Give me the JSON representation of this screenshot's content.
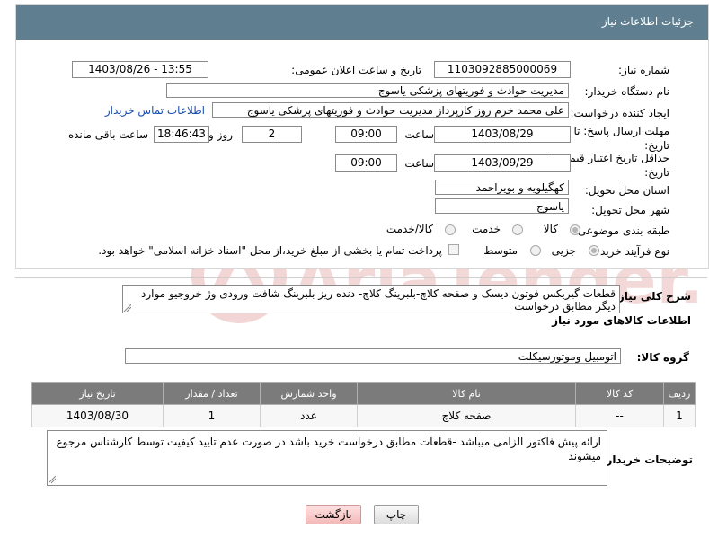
{
  "header": {
    "title": "جزئیات اطلاعات نیاز"
  },
  "fields": {
    "need_number_label": "شماره نیاز:",
    "need_number": "1103092885000069",
    "announce_label": "تاریخ و ساعت اعلان عمومی:",
    "announce_value": "1403/08/26 - 13:55",
    "buyer_org_label": "نام دستگاه خریدار:",
    "buyer_org": "مدیریت حوادث و فوریتهای پزشکی یاسوج",
    "creator_label": "ایجاد کننده درخواست:",
    "creator": "علی محمد خرم روز کارپرداز مدیریت حوادث و فوریتهای پزشکی یاسوج",
    "contact_link": "اطلاعات تماس خریدار",
    "deadline_label": "مهلت ارسال پاسخ: تا تاریخ:",
    "deadline_date": "1403/08/29",
    "time_word": "ساعت",
    "deadline_time": "09:00",
    "days_value": "2",
    "days_word": "روز و",
    "remaining_time": "18:46:43",
    "remaining_word": "ساعت باقی مانده",
    "validity_label": "حداقل تاریخ اعتبار قیمت: تا تاریخ:",
    "validity_date": "1403/09/29",
    "validity_time": "09:00",
    "province_label": "استان محل تحویل:",
    "province": "کهگیلویه و بویراحمد",
    "city_label": "شهر محل تحویل:",
    "city": "یاسوج",
    "category_label": "طبقه بندی موضوعی:",
    "category_options": [
      "کالا",
      "خدمت",
      "کالا/خدمت"
    ],
    "process_label": "نوع فرآیند خرید :",
    "process_options": [
      "جزیی",
      "متوسط"
    ],
    "payment_note": "پرداخت تمام یا بخشی از مبلغ خرید،از محل \"اسناد خزانه اسلامی\" خواهد بود."
  },
  "description": {
    "label": "شرح کلی نیاز:",
    "text": "قطعات گیربکس فوتون دیسک و صفحه کلاچ-بلبرینگ کلاچ- دنده ریز بلبرینگ شافت ورودی وژ خروجیو موارد دیگر مطابق درخواست"
  },
  "goods": {
    "section_title": "اطلاعات کالاهای مورد نیاز",
    "group_label": "گروه کالا:",
    "group_value": "اتومبیل وموتورسیکلت",
    "columns": [
      "ردیف",
      "کد کالا",
      "نام کالا",
      "واحد شمارش",
      "تعداد / مقدار",
      "تاریخ نیاز"
    ],
    "rows": [
      [
        "1",
        "--",
        "صفحه کلاچ",
        "عدد",
        "1",
        "1403/08/30"
      ]
    ]
  },
  "buyer_notes": {
    "label": "توضیحات خریدار:",
    "text": "ارائه پیش فاکتور الزامی میباشد -قطعات مطابق درخواست خرید باشد در صورت عدم تایید کیفیت توسط کارشناس مرجوع میشوند"
  },
  "buttons": {
    "print": "چاپ",
    "back": "بازگشت"
  },
  "watermark": "AriaTender.net",
  "colors": {
    "header_bg": "#5f7f90",
    "link": "#1a4fb3",
    "table_head": "#7b7b7b",
    "watermark": "#e6b5b5"
  }
}
